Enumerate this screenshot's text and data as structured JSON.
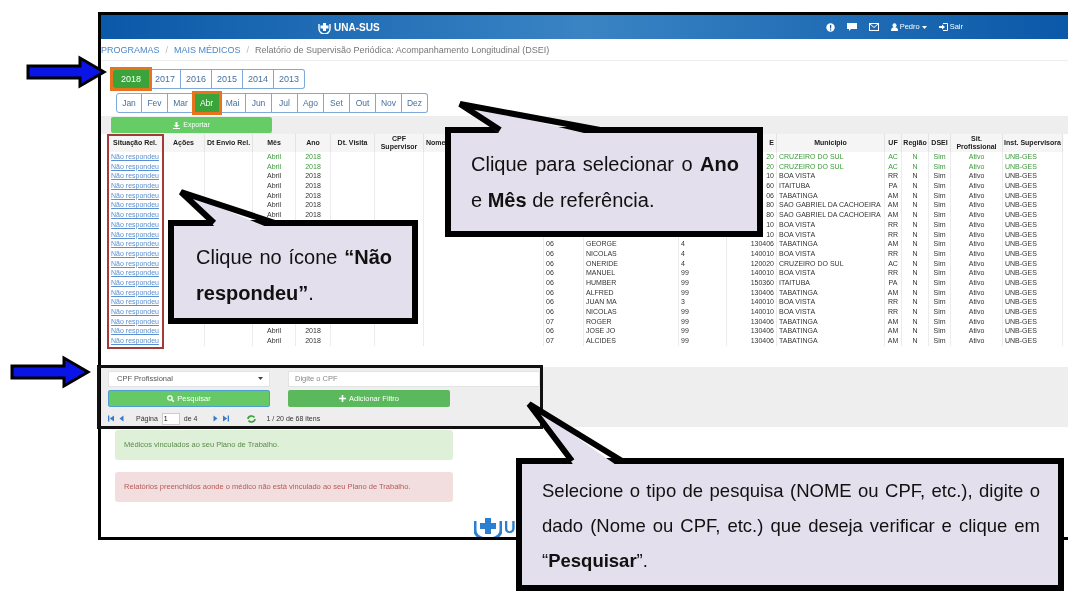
{
  "header": {
    "logo": "UNA-SUS",
    "user": "Pedro",
    "logout": "Sair"
  },
  "breadcrumb": [
    {
      "kind": "link",
      "label": "PROGRAMAS"
    },
    {
      "kind": "separator",
      "label": "/"
    },
    {
      "kind": "link",
      "label": "MAIS MÉDICOS"
    },
    {
      "kind": "separator",
      "label": "/"
    },
    {
      "kind": "current",
      "label": "Relatório de Supervisão Periódica: Acompanhamento Longitudinal (DSEI)"
    }
  ],
  "years": [
    {
      "label": "2018",
      "selected": true
    },
    {
      "label": "2017",
      "selected": false
    },
    {
      "label": "2016",
      "selected": false
    },
    {
      "label": "2015",
      "selected": false
    },
    {
      "label": "2014",
      "selected": false
    },
    {
      "label": "2013",
      "selected": false
    }
  ],
  "months": [
    {
      "label": "Jan",
      "selected": false
    },
    {
      "label": "Fev",
      "selected": false
    },
    {
      "label": "Mar",
      "selected": false
    },
    {
      "label": "Abr",
      "selected": true
    },
    {
      "label": "Mai",
      "selected": false
    },
    {
      "label": "Jun",
      "selected": false
    },
    {
      "label": "Jul",
      "selected": false
    },
    {
      "label": "Ago",
      "selected": false
    },
    {
      "label": "Set",
      "selected": false
    },
    {
      "label": "Out",
      "selected": false
    },
    {
      "label": "Nov",
      "selected": false
    },
    {
      "label": "Dez",
      "selected": false
    }
  ],
  "export_button": "Exportar",
  "table": {
    "columns": [
      "Situação Rel.",
      "Ações",
      "Dt Envio Rel.",
      "Mês",
      "Ano",
      "Dt. Visita",
      "CPF Supervisor",
      "Nome",
      null,
      null,
      null,
      "E",
      "Municipio",
      "UF",
      "Região",
      "DSEI",
      "Sit. Profissional",
      "Inst. Supervisora"
    ],
    "rows": [
      {
        "linked": true,
        "cells": [
          "Não respondeu",
          null,
          null,
          "Abril",
          "2018",
          null,
          null,
          null,
          null,
          null,
          null,
          "20",
          "CRUZEIRO DO SUL",
          "AC",
          "N",
          "Sim",
          "Ativo",
          "UNB-GES"
        ]
      },
      {
        "linked": true,
        "cells": [
          "Não respondeu",
          null,
          null,
          "Abril",
          "2018",
          null,
          null,
          null,
          null,
          null,
          null,
          "20",
          "CRUZEIRO DO SUL",
          "AC",
          "N",
          "Sim",
          "Ativo",
          "UNB-GES"
        ]
      },
      {
        "linked": false,
        "cells": [
          "Não respondeu",
          null,
          null,
          "Abril",
          "2018",
          null,
          null,
          null,
          null,
          null,
          null,
          "10",
          "BOA VISTA",
          "RR",
          "N",
          "Sim",
          "Ativo",
          "UNB-GES"
        ]
      },
      {
        "linked": false,
        "cells": [
          "Não respondeu",
          null,
          null,
          "Abril",
          "2018",
          null,
          null,
          null,
          null,
          null,
          null,
          "60",
          "ITAITUBA",
          "PA",
          "N",
          "Sim",
          "Ativo",
          "UNB-GES"
        ]
      },
      {
        "linked": false,
        "cells": [
          "Não respondeu",
          null,
          null,
          "Abril",
          "2018",
          null,
          null,
          null,
          null,
          null,
          null,
          "06",
          "TABATINGA",
          "AM",
          "N",
          "Sim",
          "Ativo",
          "UNB-GES"
        ]
      },
      {
        "linked": false,
        "cells": [
          "Não respondeu",
          null,
          null,
          "Abril",
          "2018",
          null,
          null,
          null,
          null,
          null,
          null,
          "80",
          "SAO GABRIEL DA CACHOEIRA",
          "AM",
          "N",
          "Sim",
          "Ativo",
          "UNB-GES"
        ]
      },
      {
        "linked": false,
        "cells": [
          "Não respondeu",
          null,
          null,
          "Abril",
          "2018",
          null,
          null,
          null,
          null,
          null,
          null,
          "80",
          "SAO GABRIEL DA CACHOEIRA",
          "AM",
          "N",
          "Sim",
          "Ativo",
          "UNB-GES"
        ]
      },
      {
        "linked": false,
        "cells": [
          "Não respondeu",
          null,
          null,
          null,
          null,
          null,
          null,
          null,
          null,
          null,
          null,
          "10",
          "BOA VISTA",
          "RR",
          "N",
          "Sim",
          "Ativo",
          "UNB-GES"
        ]
      },
      {
        "linked": false,
        "cells": [
          "Não respondeu",
          null,
          null,
          null,
          null,
          null,
          null,
          null,
          null,
          null,
          null,
          "10",
          "BOA VISTA",
          "RR",
          "N",
          "Sim",
          "Ativo",
          "UNB-GES"
        ]
      },
      {
        "linked": false,
        "cells": [
          "Não respondeu",
          null,
          null,
          null,
          null,
          null,
          null,
          null,
          "06",
          "GEORGE",
          "4",
          "130406",
          "TABATINGA",
          "AM",
          "N",
          "Sim",
          "Ativo",
          "UNB-GES"
        ]
      },
      {
        "linked": false,
        "cells": [
          "Não respondeu",
          null,
          null,
          null,
          null,
          null,
          null,
          null,
          "06",
          "NICOLAS",
          "4",
          "140010",
          "BOA VISTA",
          "RR",
          "N",
          "Sim",
          "Ativo",
          "UNB-GES"
        ]
      },
      {
        "linked": false,
        "cells": [
          "Não respondeu",
          null,
          null,
          null,
          null,
          null,
          null,
          null,
          "06",
          "ONERIDE",
          "4",
          "120020",
          "CRUZEIRO DO SUL",
          "AC",
          "N",
          "Sim",
          "Ativo",
          "UNB-GES"
        ]
      },
      {
        "linked": false,
        "cells": [
          "Não respondeu",
          null,
          null,
          null,
          null,
          null,
          null,
          null,
          "06",
          "MANUEL",
          "99",
          "140010",
          "BOA VISTA",
          "RR",
          "N",
          "Sim",
          "Ativo",
          "UNB-GES"
        ]
      },
      {
        "linked": false,
        "cells": [
          "Não respondeu",
          null,
          null,
          null,
          null,
          null,
          null,
          null,
          "06",
          "HUMBER",
          "99",
          "150360",
          "ITAITUBA",
          "PA",
          "N",
          "Sim",
          "Ativo",
          "UNB-GES"
        ]
      },
      {
        "linked": false,
        "cells": [
          "Não respondeu",
          null,
          null,
          null,
          null,
          null,
          null,
          null,
          "06",
          "ALFRED",
          "99",
          "130406",
          "TABATINGA",
          "AM",
          "N",
          "Sim",
          "Ativo",
          "UNB-GES"
        ]
      },
      {
        "linked": false,
        "cells": [
          "Não respondeu",
          null,
          null,
          null,
          null,
          null,
          null,
          null,
          "06",
          "JUAN MA",
          "3",
          "140010",
          "BOA VISTA",
          "RR",
          "N",
          "Sim",
          "Ativo",
          "UNB-GES"
        ]
      },
      {
        "linked": false,
        "cells": [
          "Não respondeu",
          null,
          null,
          null,
          null,
          null,
          null,
          null,
          "06",
          "NICOLAS",
          "99",
          "140010",
          "BOA VISTA",
          "RR",
          "N",
          "Sim",
          "Ativo",
          "UNB-GES"
        ]
      },
      {
        "linked": false,
        "cells": [
          "Não respondeu",
          null,
          null,
          null,
          null,
          null,
          null,
          null,
          "07",
          "ROGER",
          "99",
          "130406",
          "TABATINGA",
          "AM",
          "N",
          "Sim",
          "Ativo",
          "UNB-GES"
        ]
      },
      {
        "linked": false,
        "cells": [
          "Não respondeu",
          null,
          null,
          "Abril",
          "2018",
          null,
          null,
          null,
          "06",
          "JOSE JO",
          "99",
          "130406",
          "TABATINGA",
          "AM",
          "N",
          "Sim",
          "Ativo",
          "UNB-GES"
        ]
      },
      {
        "linked": false,
        "cells": [
          "Não respondeu",
          null,
          null,
          "Abril",
          "2018",
          null,
          null,
          null,
          "07",
          "ALCIDES",
          "99",
          "130406",
          "TABATINGA",
          "AM",
          "N",
          "Sim",
          "Ativo",
          "UNB-GES"
        ]
      }
    ]
  },
  "search": {
    "type": "CPF Profissional",
    "placeholder": "Digite o CPF",
    "search_button": "Pesquisar",
    "filter_button": "Adicionar Filtro"
  },
  "pager": {
    "page_label": "Página",
    "page": "1",
    "of": "de 4",
    "summary": "1 / 20 de 68 itens"
  },
  "alerts": [
    {
      "kind": "success",
      "text": "Médicos vinculados ao seu Plano de Trabalho."
    },
    {
      "kind": "danger",
      "text": "Relatórios preenchidos aonde o médico não está vinculado ao seu Plano de Trabalho."
    }
  ],
  "footer_logo": "U",
  "callouts": [
    {
      "text": "Clique para selecionar o **Ano** e **Mês** de referência."
    },
    {
      "text": "Clique no ícone **“Não respondeu”**."
    },
    {
      "text": "Selecione o tipo de pesquisa (NOME ou CPF, etc.), digite o dado (Nome ou CPF, etc.) que deseja verificar e clique em “**Pesquisar**”."
    }
  ]
}
